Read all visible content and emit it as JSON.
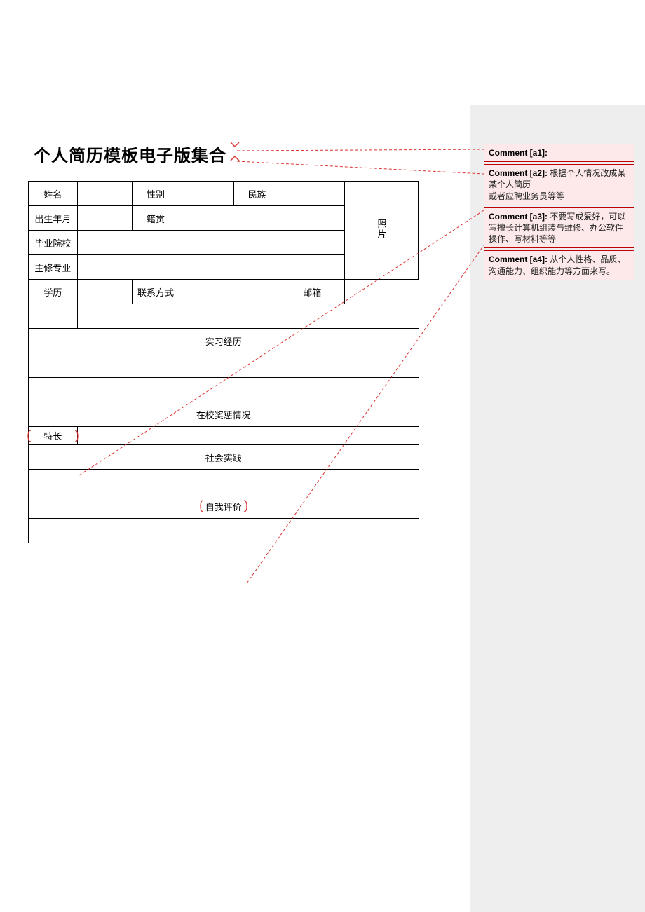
{
  "title": "个人简历模板电子版集合",
  "labels": {
    "name": "姓名",
    "gender": "性别",
    "ethnicity": "民族",
    "birth": "出生年月",
    "native_place": "籍贯",
    "photo": "照片",
    "school": "毕业院校",
    "major": "主修专业",
    "education": "学历",
    "contact": "联系方式",
    "email": "邮箱",
    "internship": "实习经历",
    "school_awards": "在校奖惩情况",
    "strength": "特长",
    "social_practice": "社会实践",
    "self_eval": "自我评价"
  },
  "comments": [
    {
      "id": "a1",
      "label": "Comment [a1]:",
      "text": ""
    },
    {
      "id": "a2",
      "label": "Comment [a2]:",
      "text": "根据个人情况改成某某个人简历\n或者应聘业务员等等"
    },
    {
      "id": "a3",
      "label": "Comment [a3]:",
      "text": "不要写成爱好，可以写擅长计算机组装与维修、办公软件操作、写材料等等"
    },
    {
      "id": "a4",
      "label": "Comment [a4]:",
      "text": "从个人性格、品质、沟通能力、组织能力等方面来写。"
    }
  ]
}
